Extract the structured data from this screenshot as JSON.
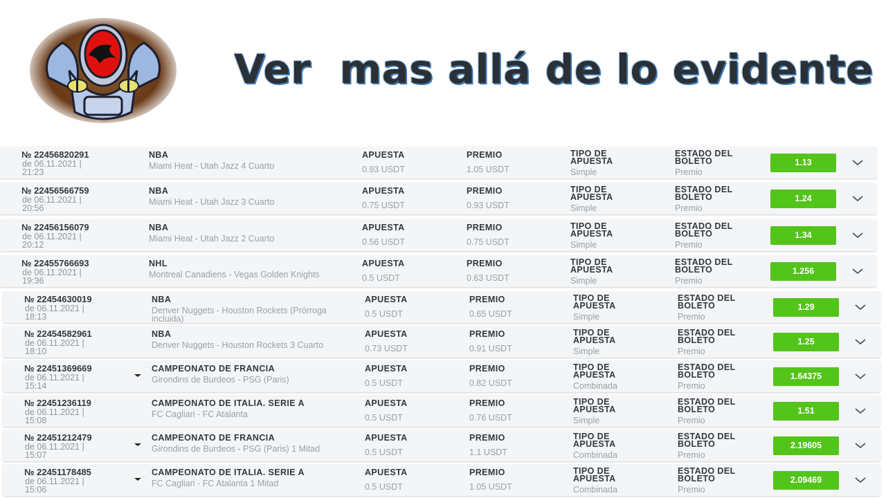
{
  "headline": "Ver  mas allá de lo evidente",
  "labels": {
    "bet": "APUESTA",
    "prize": "PREMIO",
    "type": "TIPO DE APUESTA",
    "status": "ESTADO DEL BOLETO"
  },
  "rows": [
    {
      "id": "№ 22456820291",
      "date": "de 06.11.2021 | 21:23",
      "league": "NBA",
      "event": "Miami Heat - Utah Jazz 4 Cuarto",
      "bet": "0.93 USDT",
      "prize": "1.05 USDT",
      "type": "Simple",
      "status": "Premio",
      "odds": "1.13",
      "caret": false
    },
    {
      "id": "№ 22456566759",
      "date": "de 06.11.2021 | 20:56",
      "league": "NBA",
      "event": "Miami Heat - Utah Jazz 3 Cuarto",
      "bet": "0.75 USDT",
      "prize": "0.93 USDT",
      "type": "Simple",
      "status": "Premio",
      "odds": "1.24",
      "caret": false
    },
    {
      "id": "№ 22456156079",
      "date": "de 06.11.2021 | 20:12",
      "league": "NBA",
      "event": "Miami Heat - Utah Jazz 2 Cuarto",
      "bet": "0.56 USDT",
      "prize": "0.75 USDT",
      "type": "Simple",
      "status": "Premio",
      "odds": "1.34",
      "caret": false
    },
    {
      "id": "№ 22455766693",
      "date": "de 06.11.2021 | 19:36",
      "league": "NHL",
      "event": "Montreal Canadiens - Vegas Golden Knights",
      "bet": "0.5 USDT",
      "prize": "0.63 USDT",
      "type": "Simple",
      "status": "Premio",
      "odds": "1.256",
      "caret": false
    },
    {
      "id": "№ 22454630019",
      "date": "de 06.11.2021 | 18:13",
      "league": "NBA",
      "event": "Denver Nuggets - Houston Rockets (Prórroga incluida)",
      "bet": "0.5 USDT",
      "prize": "0.65 USDT",
      "type": "Simple",
      "status": "Premio",
      "odds": "1.29",
      "caret": false
    },
    {
      "id": "№ 22454582961",
      "date": "de 06.11.2021 | 18:10",
      "league": "NBA",
      "event": "Denver Nuggets - Houston Rockets 3 Cuarto",
      "bet": "0.73 USDT",
      "prize": "0.91 USDT",
      "type": "Simple",
      "status": "Premio",
      "odds": "1.25",
      "caret": false
    },
    {
      "id": "№ 22451369669",
      "date": "de 06.11.2021 | 15:14",
      "league": "CAMPEONATO DE FRANCIA",
      "event": "Girondins de Burdeos - PSG (Paris)",
      "bet": "0.5 USDT",
      "prize": "0.82 USDT",
      "type": "Combinada",
      "status": "Premio",
      "odds": "1.64375",
      "caret": true
    },
    {
      "id": "№ 22451236119",
      "date": "de 06.11.2021 | 15:08",
      "league": "CAMPEONATO DE ITALIA. SERIE A",
      "event": "FC Cagliari - FC Atalanta",
      "bet": "0.5 USDT",
      "prize": "0.76 USDT",
      "type": "Simple",
      "status": "Premio",
      "odds": "1.51",
      "caret": false
    },
    {
      "id": "№ 22451212479",
      "date": "de 06.11.2021 | 15:07",
      "league": "CAMPEONATO DE FRANCIA",
      "event": "Girondins de Burdeos - PSG (Paris) 1 Mitad",
      "bet": "0.5 USDT",
      "prize": "1.1 USDT",
      "type": "Combinada",
      "status": "Premio",
      "odds": "2.19605",
      "caret": true
    },
    {
      "id": "№ 22451178485",
      "date": "de 06.11.2021 | 15:06",
      "league": "CAMPEONATO DE ITALIA. SERIE A",
      "event": "FC Cagliari - FC Atalanta 1 Mitad",
      "bet": "0.5 USDT",
      "prize": "1.05 USDT",
      "type": "Combinada",
      "status": "Premio",
      "odds": "2.09469",
      "caret": true
    }
  ],
  "colors": {
    "accent": "#52c41a",
    "row_bg": "#f3f5f7"
  },
  "icons": {
    "expand": "chevron-down-icon",
    "logo": "thundercats-emblem"
  }
}
